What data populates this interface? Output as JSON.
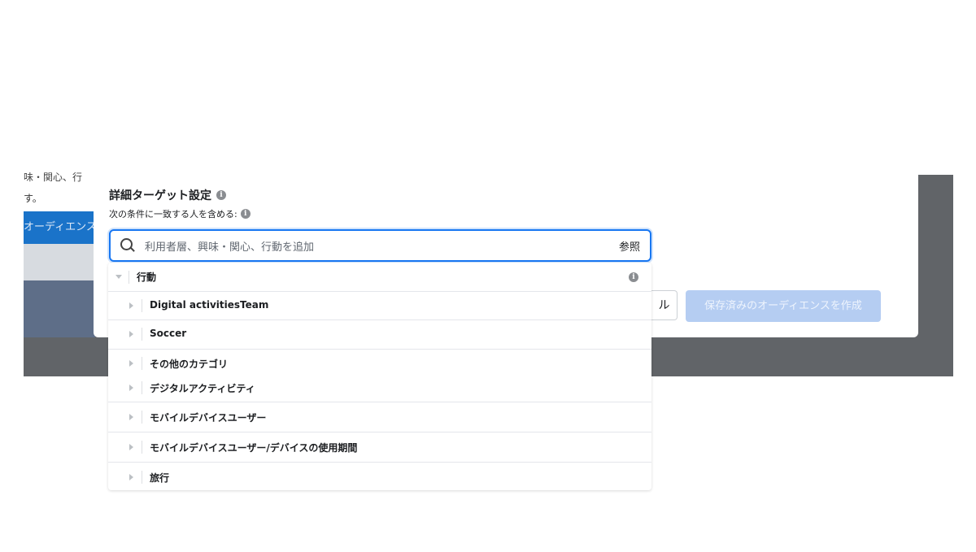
{
  "background": {
    "fragment_line1": "味・関心、行",
    "fragment_line2": "す。",
    "fragment_button": "オーディエンス"
  },
  "dialog": {
    "section_title": "詳細ターゲット設定",
    "include_label": "次の条件に一致する人を含める:",
    "search": {
      "placeholder": "利用者層、興味・関心、行動を追加",
      "browse_label": "参照"
    },
    "cancel_fragment": "ル",
    "create_button": "保存済みのオーディエンスを作成"
  },
  "dropdown": {
    "category": "行動",
    "items": [
      {
        "label": "Digital activitiesTeam"
      },
      {
        "label": "Soccer"
      },
      {
        "label": "その他のカテゴリ"
      },
      {
        "label": "デジタルアクティビティ"
      },
      {
        "label": "モバイルデバイスユーザー"
      },
      {
        "label": "モバイルデバイスユーザー/デバイスの使用期間"
      },
      {
        "label": "旅行"
      }
    ]
  },
  "colors": {
    "accent": "#1877f2",
    "backdrop": "#616468",
    "disabled_button": "#b5cdf2"
  }
}
